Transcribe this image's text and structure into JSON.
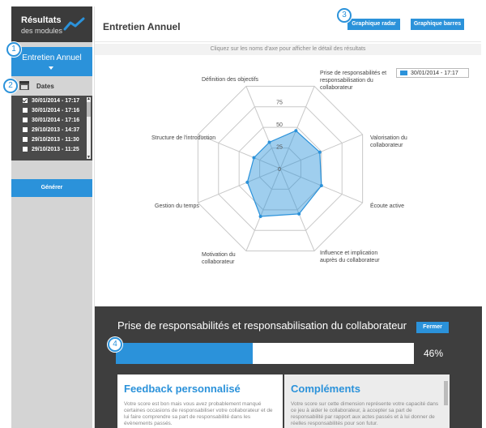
{
  "sidebar": {
    "logo_title": "Résultats",
    "logo_subtitle": "des modules",
    "module_label": "Entretien Annuel",
    "dates_label": "Dates",
    "dates": [
      {
        "label": "30/01/2014 - 17:17",
        "checked": true
      },
      {
        "label": "30/01/2014 - 17:16",
        "checked": false
      },
      {
        "label": "30/01/2014 - 17:16",
        "checked": false
      },
      {
        "label": "29/10/2013 - 14:37",
        "checked": false
      },
      {
        "label": "29/10/2013 - 11:30",
        "checked": false
      },
      {
        "label": "29/10/2013 - 11:25",
        "checked": false
      }
    ],
    "generate_label": "Générer"
  },
  "main": {
    "title": "Entretien Annuel",
    "radar_button": "Graphique radar",
    "bars_button": "Graphique barres",
    "hint": "Cliquez sur les noms d'axe pour afficher le détail des résultats"
  },
  "callouts": [
    "1",
    "2",
    "3",
    "4"
  ],
  "chart_data": {
    "type": "radar",
    "title": "",
    "legend": "30/01/2014 - 17:17",
    "legend_position": "top-right",
    "axes": [
      "Prise de responsabilités et responsabilisation du collaborateur",
      "Valorisation du collaborateur",
      "Écoute active",
      "Influence et implication auprès du collaborateur",
      "Motivation du collaborateur",
      "Gestion du temps",
      "Structure de l'introduction",
      "Définition des objectifs"
    ],
    "rlim": [
      0,
      100
    ],
    "ticks": [
      "0",
      "25",
      "50",
      "75"
    ],
    "series": [
      {
        "name": "30/01/2014 - 17:17",
        "values": [
          46,
          48,
          50,
          55,
          58,
          40,
          32,
          32
        ]
      }
    ],
    "color": "#2b92da"
  },
  "detail": {
    "title": "Prise de responsabilités et responsabilisation du collaborateur",
    "close_label": "Fermer",
    "progress": 0.46,
    "percent_text": "46%",
    "feedback_title": "Feedback personnalisé",
    "feedback_text": "Votre score est bon mais vous avez probablement manqué certaines occasions de responsabiliser votre collaborateur et de lui faire comprendre sa part de responsabilité dans les évènements passés.",
    "complements_title": "Compléments",
    "complements_text": "Votre score sur cette dimension représente votre capacité dans ce jeu à aider le collaborateur, à accepter sa part de responsabilité par rapport aux actes passés et à lui donner de réelles responsabilités pour son futur."
  }
}
